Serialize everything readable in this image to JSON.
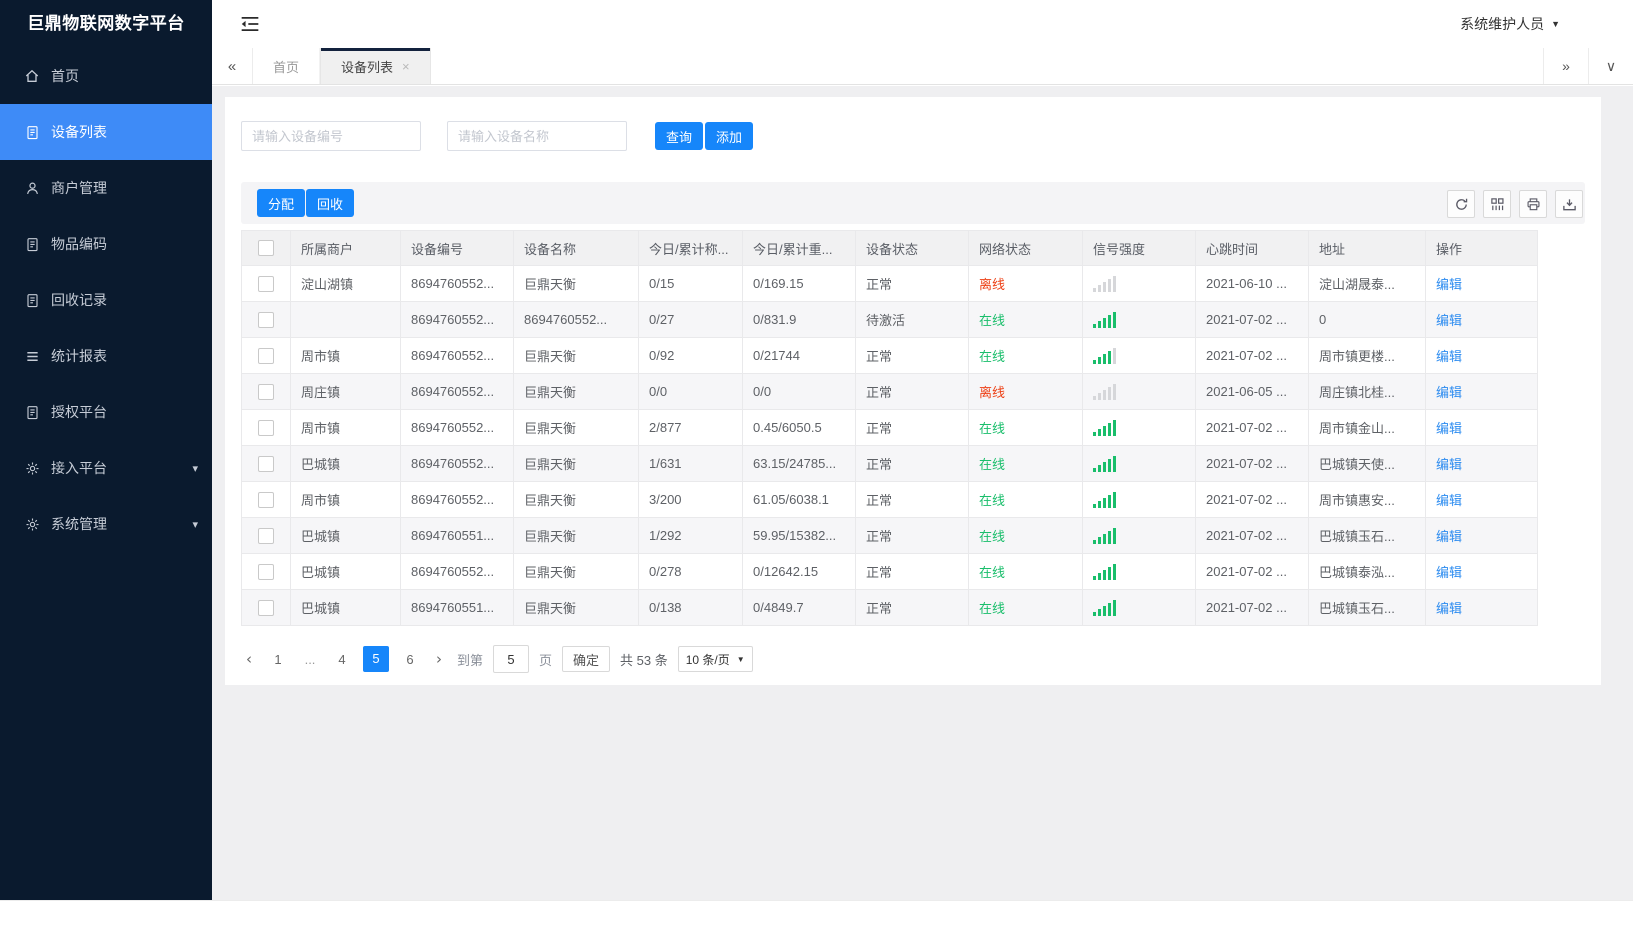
{
  "app": {
    "title": "巨鼎物联网数字平台",
    "user_menu": "系统维护人员",
    "menu_icon": "menu-fold-icon",
    "user_caret_icon": "caret-down-icon"
  },
  "colors": {
    "primary_blue": "#1686fa",
    "sidebar_bg": "#0a1a2e",
    "sidebar_active_blue": "#3e8bf7",
    "online_green": "#19be6b",
    "offline_red": "#ed3f14",
    "link_blue": "#2d8cf0",
    "tab_active_border": "#13223d"
  },
  "sidebar": {
    "items": [
      {
        "name": "home",
        "label": "首页",
        "icon": "home-icon",
        "active": false,
        "expandable": false
      },
      {
        "name": "device-list",
        "label": "设备列表",
        "icon": "doc-icon",
        "active": true,
        "expandable": false
      },
      {
        "name": "merchant-management",
        "label": "商户管理",
        "icon": "user-icon",
        "active": false,
        "expandable": false
      },
      {
        "name": "item-code",
        "label": "物品编码",
        "icon": "doc-icon",
        "active": false,
        "expandable": false
      },
      {
        "name": "recycle-records",
        "label": "回收记录",
        "icon": "doc-icon",
        "active": false,
        "expandable": false
      },
      {
        "name": "statistics-report",
        "label": "统计报表",
        "icon": "list-icon",
        "active": false,
        "expandable": false
      },
      {
        "name": "authorization-platform",
        "label": "授权平台",
        "icon": "doc-icon",
        "active": false,
        "expandable": false
      },
      {
        "name": "access-platform",
        "label": "接入平台",
        "icon": "gear-icon",
        "active": false,
        "expandable": true
      },
      {
        "name": "system-management",
        "label": "系统管理",
        "icon": "gear-icon",
        "active": false,
        "expandable": true
      }
    ]
  },
  "tabs": {
    "collapse_left_icon": "double-chevron-left-icon",
    "collapse_right_icon": "double-chevron-right-icon",
    "dropdown_icon": "chevron-down-icon",
    "items": [
      {
        "name": "home",
        "label": "首页",
        "active": false,
        "closable": false
      },
      {
        "name": "device-list",
        "label": "设备列表",
        "active": true,
        "closable": true
      }
    ]
  },
  "search": {
    "inputs": [
      {
        "placeholder": "请输入设备编号",
        "value": ""
      },
      {
        "placeholder": "请输入设备名称",
        "value": ""
      }
    ],
    "query_label": "查询",
    "add_label": "添加"
  },
  "toolbar": {
    "assign_label": "分配",
    "recycle_label": "回收",
    "icons": [
      "refresh-icon",
      "columns-icon",
      "printer-icon",
      "export-icon"
    ]
  },
  "table": {
    "headers": [
      "所属商户",
      "设备编号",
      "设备名称",
      "今日/累计称...",
      "今日/累计重...",
      "设备状态",
      "网络状态",
      "信号强度",
      "心跳时间",
      "地址",
      "操作"
    ],
    "edit_label": "编辑",
    "rows": [
      {
        "merchant": "淀山湖镇",
        "device_no": "8694760552...",
        "device_name": "巨鼎天衡",
        "today_total_count": "0/15",
        "today_total_weight": "0/169.15",
        "device_status": "正常",
        "network_status": "离线",
        "online": false,
        "signal_level": 0,
        "heartbeat": "2021-06-10 ...",
        "address": "淀山湖晟泰..."
      },
      {
        "merchant": "",
        "device_no": "8694760552...",
        "device_name": "8694760552...",
        "today_total_count": "0/27",
        "today_total_weight": "0/831.9",
        "device_status": "待激活",
        "network_status": "在线",
        "online": true,
        "signal_level": 5,
        "heartbeat": "2021-07-02 ...",
        "address": "0"
      },
      {
        "merchant": "周市镇",
        "device_no": "8694760552...",
        "device_name": "巨鼎天衡",
        "today_total_count": "0/92",
        "today_total_weight": "0/21744",
        "device_status": "正常",
        "network_status": "在线",
        "online": true,
        "signal_level": 4,
        "heartbeat": "2021-07-02 ...",
        "address": "周市镇更楼..."
      },
      {
        "merchant": "周庄镇",
        "device_no": "8694760552...",
        "device_name": "巨鼎天衡",
        "today_total_count": "0/0",
        "today_total_weight": "0/0",
        "device_status": "正常",
        "network_status": "离线",
        "online": false,
        "signal_level": 0,
        "heartbeat": "2021-06-05 ...",
        "address": "周庄镇北桂..."
      },
      {
        "merchant": "周市镇",
        "device_no": "8694760552...",
        "device_name": "巨鼎天衡",
        "today_total_count": "2/877",
        "today_total_weight": "0.45/6050.5",
        "device_status": "正常",
        "network_status": "在线",
        "online": true,
        "signal_level": 5,
        "heartbeat": "2021-07-02 ...",
        "address": "周市镇金山..."
      },
      {
        "merchant": "巴城镇",
        "device_no": "8694760552...",
        "device_name": "巨鼎天衡",
        "today_total_count": "1/631",
        "today_total_weight": "63.15/24785...",
        "device_status": "正常",
        "network_status": "在线",
        "online": true,
        "signal_level": 5,
        "heartbeat": "2021-07-02 ...",
        "address": "巴城镇天使..."
      },
      {
        "merchant": "周市镇",
        "device_no": "8694760552...",
        "device_name": "巨鼎天衡",
        "today_total_count": "3/200",
        "today_total_weight": "61.05/6038.1",
        "device_status": "正常",
        "network_status": "在线",
        "online": true,
        "signal_level": 5,
        "heartbeat": "2021-07-02 ...",
        "address": "周市镇惠安..."
      },
      {
        "merchant": "巴城镇",
        "device_no": "8694760551...",
        "device_name": "巨鼎天衡",
        "today_total_count": "1/292",
        "today_total_weight": "59.95/15382...",
        "device_status": "正常",
        "network_status": "在线",
        "online": true,
        "signal_level": 5,
        "heartbeat": "2021-07-02 ...",
        "address": "巴城镇玉石..."
      },
      {
        "merchant": "巴城镇",
        "device_no": "8694760552...",
        "device_name": "巨鼎天衡",
        "today_total_count": "0/278",
        "today_total_weight": "0/12642.15",
        "device_status": "正常",
        "network_status": "在线",
        "online": true,
        "signal_level": 5,
        "heartbeat": "2021-07-02 ...",
        "address": "巴城镇泰泓..."
      },
      {
        "merchant": "巴城镇",
        "device_no": "8694760551...",
        "device_name": "巨鼎天衡",
        "today_total_count": "0/138",
        "today_total_weight": "0/4849.7",
        "device_status": "正常",
        "network_status": "在线",
        "online": true,
        "signal_level": 5,
        "heartbeat": "2021-07-02 ...",
        "address": "巴城镇玉石..."
      }
    ]
  },
  "pagination": {
    "prev_icon": "chevron-left-icon",
    "next_icon": "chevron-right-icon",
    "pages": [
      "1",
      "...",
      "4",
      "5",
      "6"
    ],
    "active_page": "5",
    "goto_prefix": "到第",
    "goto_value": "5",
    "goto_suffix": "页",
    "confirm_label": "确定",
    "total_label": "共 53 条",
    "page_size_label": "10 条/页",
    "page_size_caret_icon": "caret-down-icon"
  }
}
